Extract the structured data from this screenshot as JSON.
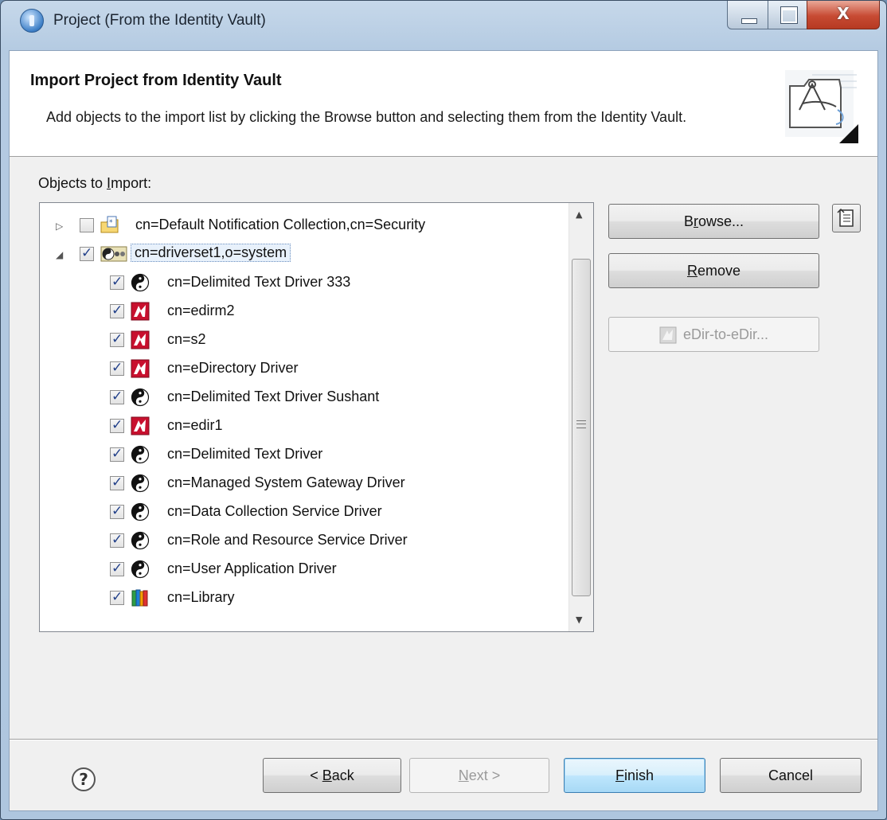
{
  "window": {
    "title": "Project (From the Identity Vault)",
    "close_glyph": "X"
  },
  "banner": {
    "title": "Import Project from Identity Vault",
    "description": "Add objects to the import list by clicking the Browse button and selecting them from the Identity Vault."
  },
  "objects_label_pre": "Objects to ",
  "objects_label_u": "I",
  "objects_label_post": "mport:",
  "tree": {
    "items": [
      {
        "label": "cn=Default Notification Collection,cn=Security",
        "checked": false,
        "icon": "notification-folder-icon",
        "expander": "collapsed"
      },
      {
        "label": "cn=driverset1,o=system",
        "checked": true,
        "icon": "driverset-icon",
        "expander": "expanded",
        "selected": true
      },
      {
        "label": "cn=Delimited Text Driver 333",
        "checked": true,
        "icon": "yin-yang-driver-icon"
      },
      {
        "label": "cn=edirm2",
        "checked": true,
        "icon": "edirectory-driver-icon"
      },
      {
        "label": "cn=s2",
        "checked": true,
        "icon": "edirectory-driver-icon"
      },
      {
        "label": "cn=eDirectory Driver",
        "checked": true,
        "icon": "edirectory-driver-icon"
      },
      {
        "label": "cn=Delimited Text Driver Sushant",
        "checked": true,
        "icon": "yin-yang-driver-icon"
      },
      {
        "label": "cn=edir1",
        "checked": true,
        "icon": "edirectory-driver-icon"
      },
      {
        "label": "cn=Delimited Text Driver",
        "checked": true,
        "icon": "yin-yang-driver-icon"
      },
      {
        "label": "cn=Managed System Gateway Driver",
        "checked": true,
        "icon": "yin-yang-driver-icon"
      },
      {
        "label": "cn=Data Collection Service Driver",
        "checked": true,
        "icon": "yin-yang-driver-icon"
      },
      {
        "label": "cn=Role and Resource Service Driver",
        "checked": true,
        "icon": "yin-yang-driver-icon"
      },
      {
        "label": "cn=User Application Driver",
        "checked": true,
        "icon": "yin-yang-driver-icon"
      },
      {
        "label": "cn=Library",
        "checked": true,
        "icon": "library-books-icon"
      }
    ]
  },
  "buttons": {
    "browse": {
      "pre": "B",
      "u": "r",
      "post": "owse..."
    },
    "remove": {
      "pre": "",
      "u": "R",
      "post": "emove"
    },
    "edir": "eDir-to-eDir...",
    "back": {
      "pre": "< ",
      "u": "B",
      "post": "ack"
    },
    "next": {
      "pre": "",
      "u": "N",
      "post": "ext >"
    },
    "finish": {
      "pre": "",
      "u": "F",
      "post": "inish"
    },
    "cancel": "Cancel"
  },
  "help_glyph": "?",
  "colors": {
    "accent": "#3c7fb1",
    "close": "#c74a33"
  }
}
